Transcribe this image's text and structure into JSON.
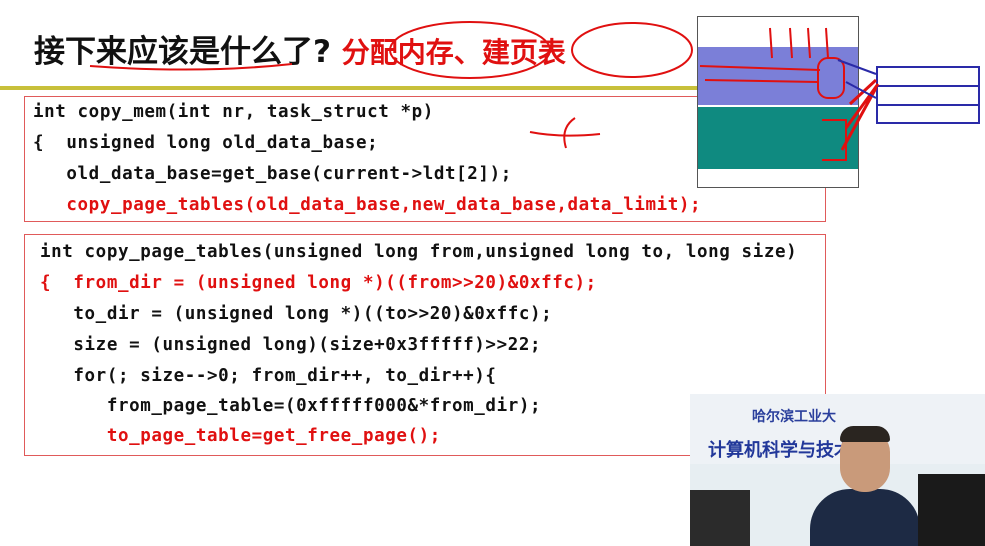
{
  "slide": {
    "title_black": "接下来应该是什么了?",
    "title_red_1": "分配内存",
    "title_sep": "、",
    "title_red_2": "建页表",
    "code_block_1": [
      {
        "text": "int copy_mem(int nr, task_struct *p)",
        "color": "#111111"
      },
      {
        "text": "{  unsigned long old_data_base;",
        "color": "#111111"
      },
      {
        "text": "   old_data_base=get_base(current->ldt[2]);",
        "color": "#111111"
      },
      {
        "text": "   copy_page_tables(old_data_base,new_data_base,data_limit);",
        "color": "#e01010"
      }
    ],
    "code_block_2": [
      {
        "text": "int copy_page_tables(unsigned long from,unsigned long to, long size)",
        "color": "#111111"
      },
      {
        "text": "{  from_dir = (unsigned long *)((from>>20)&0xffc);",
        "color": "#e01010"
      },
      {
        "text": "   to_dir = (unsigned long *)((to>>20)&0xffc);",
        "color": "#111111"
      },
      {
        "text": "   size = (unsigned long)(size+0x3fffff)>>22;",
        "color": "#111111"
      },
      {
        "text": "   for(; size-->0; from_dir++, to_dir++){",
        "color": "#111111"
      },
      {
        "text": "      from_page_table=(0xfffff000&*from_dir);",
        "color": "#111111"
      },
      {
        "text": "      to_page_table=get_free_page();",
        "color": "#e01010"
      }
    ]
  },
  "video": {
    "banner_top": "哈尔滨工业大",
    "banner_main": "计算机科学与技术学院"
  },
  "colors": {
    "accent_red": "#e01010",
    "title_rule": "#c8c03a",
    "memory_blue": "#7b7fd8",
    "memory_teal": "#0f8a80",
    "table_blue": "#2a2aa8"
  }
}
